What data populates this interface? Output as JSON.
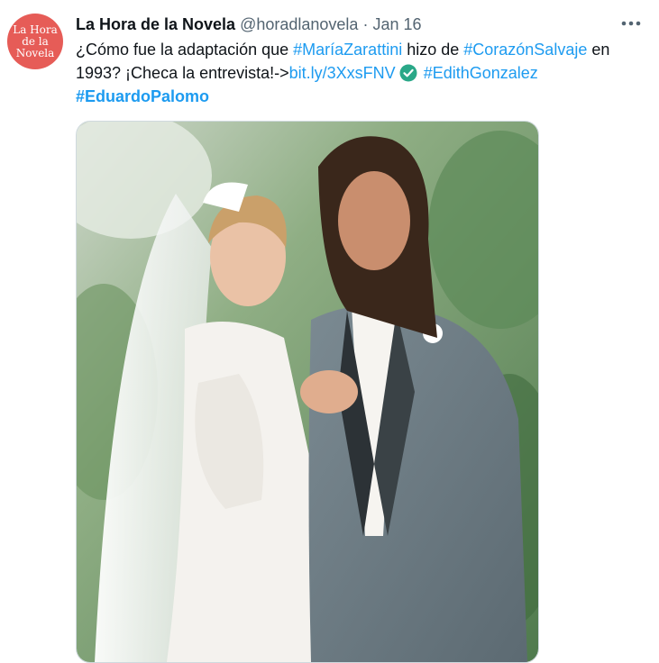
{
  "tweet": {
    "avatar": {
      "line1": "La Hora",
      "line2": "de la",
      "line3": "Novela",
      "bg_color": "#e65c57"
    },
    "author_name": "La Hora de la Novela",
    "handle": "@horadlanovela",
    "separator": "·",
    "time": "Jan 16",
    "more_icon": "more-horizontal-icon",
    "text": {
      "part1": "¿Cómo fue la adaptación que ",
      "tag1": "#MaríaZarattini",
      "part2": " hizo de ",
      "tag2": "#CorazónSalvaje",
      "part3": " en 1993? ¡Checa la entrevista!->",
      "link": "bit.ly/3XxsFNV",
      "check_icon": "check-circle-icon",
      "tag3": "#EdithGonzalez",
      "tag4": "#EduardoPalomo"
    },
    "link_color": "#1d9bf0",
    "check_color": "#2aa888"
  }
}
